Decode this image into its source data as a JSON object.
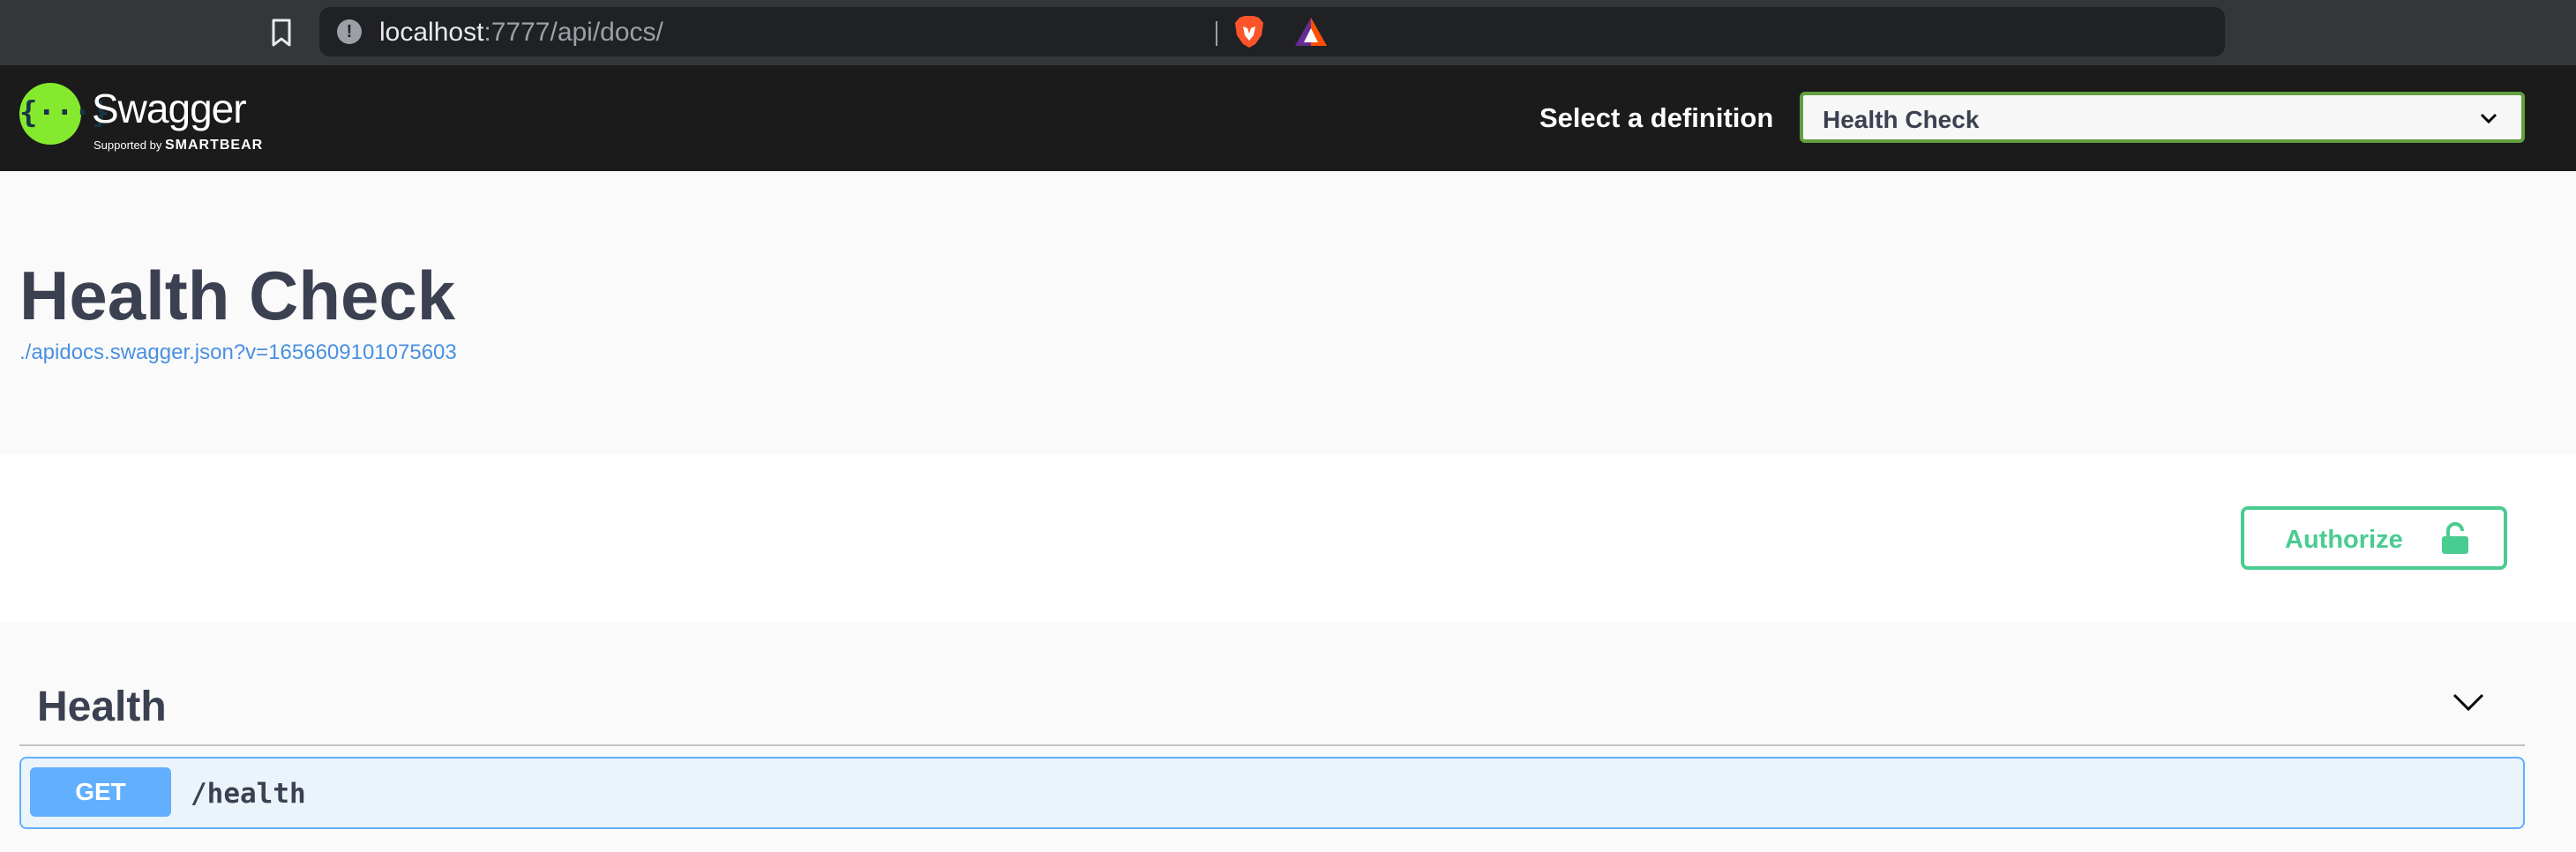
{
  "browser": {
    "url_host": "localhost",
    "url_rest": ":7777/api/docs/"
  },
  "topbar": {
    "logo_name": "Swagger",
    "logo_supported_by": "Supported by",
    "logo_brand": "SMARTBEAR",
    "select_label": "Select a definition",
    "selected_definition": "Health Check"
  },
  "info": {
    "title": "Health Check",
    "spec_url": "./apidocs.swagger.json?v=1656609101075603"
  },
  "scheme": {
    "authorize_label": "Authorize"
  },
  "tag": {
    "name": "Health",
    "operations": [
      {
        "method": "GET",
        "path": "/health"
      }
    ]
  },
  "colors": {
    "topbar_bg": "#1b1b1b",
    "logo_green": "#85ea2d",
    "select_border": "#62a03f",
    "authorize_green": "#49cc90",
    "get_blue": "#61affe",
    "link_blue": "#4990e2",
    "text_dark": "#3b4151"
  },
  "icons": {
    "bookmark": "bookmark-icon",
    "site_info": "info-icon",
    "brave": "brave-lion-icon",
    "rewards": "triangle-icon",
    "select_chevron": "chevron-down-icon",
    "lock": "unlocked-lock-icon",
    "tag_toggle": "chevron-down-icon"
  }
}
